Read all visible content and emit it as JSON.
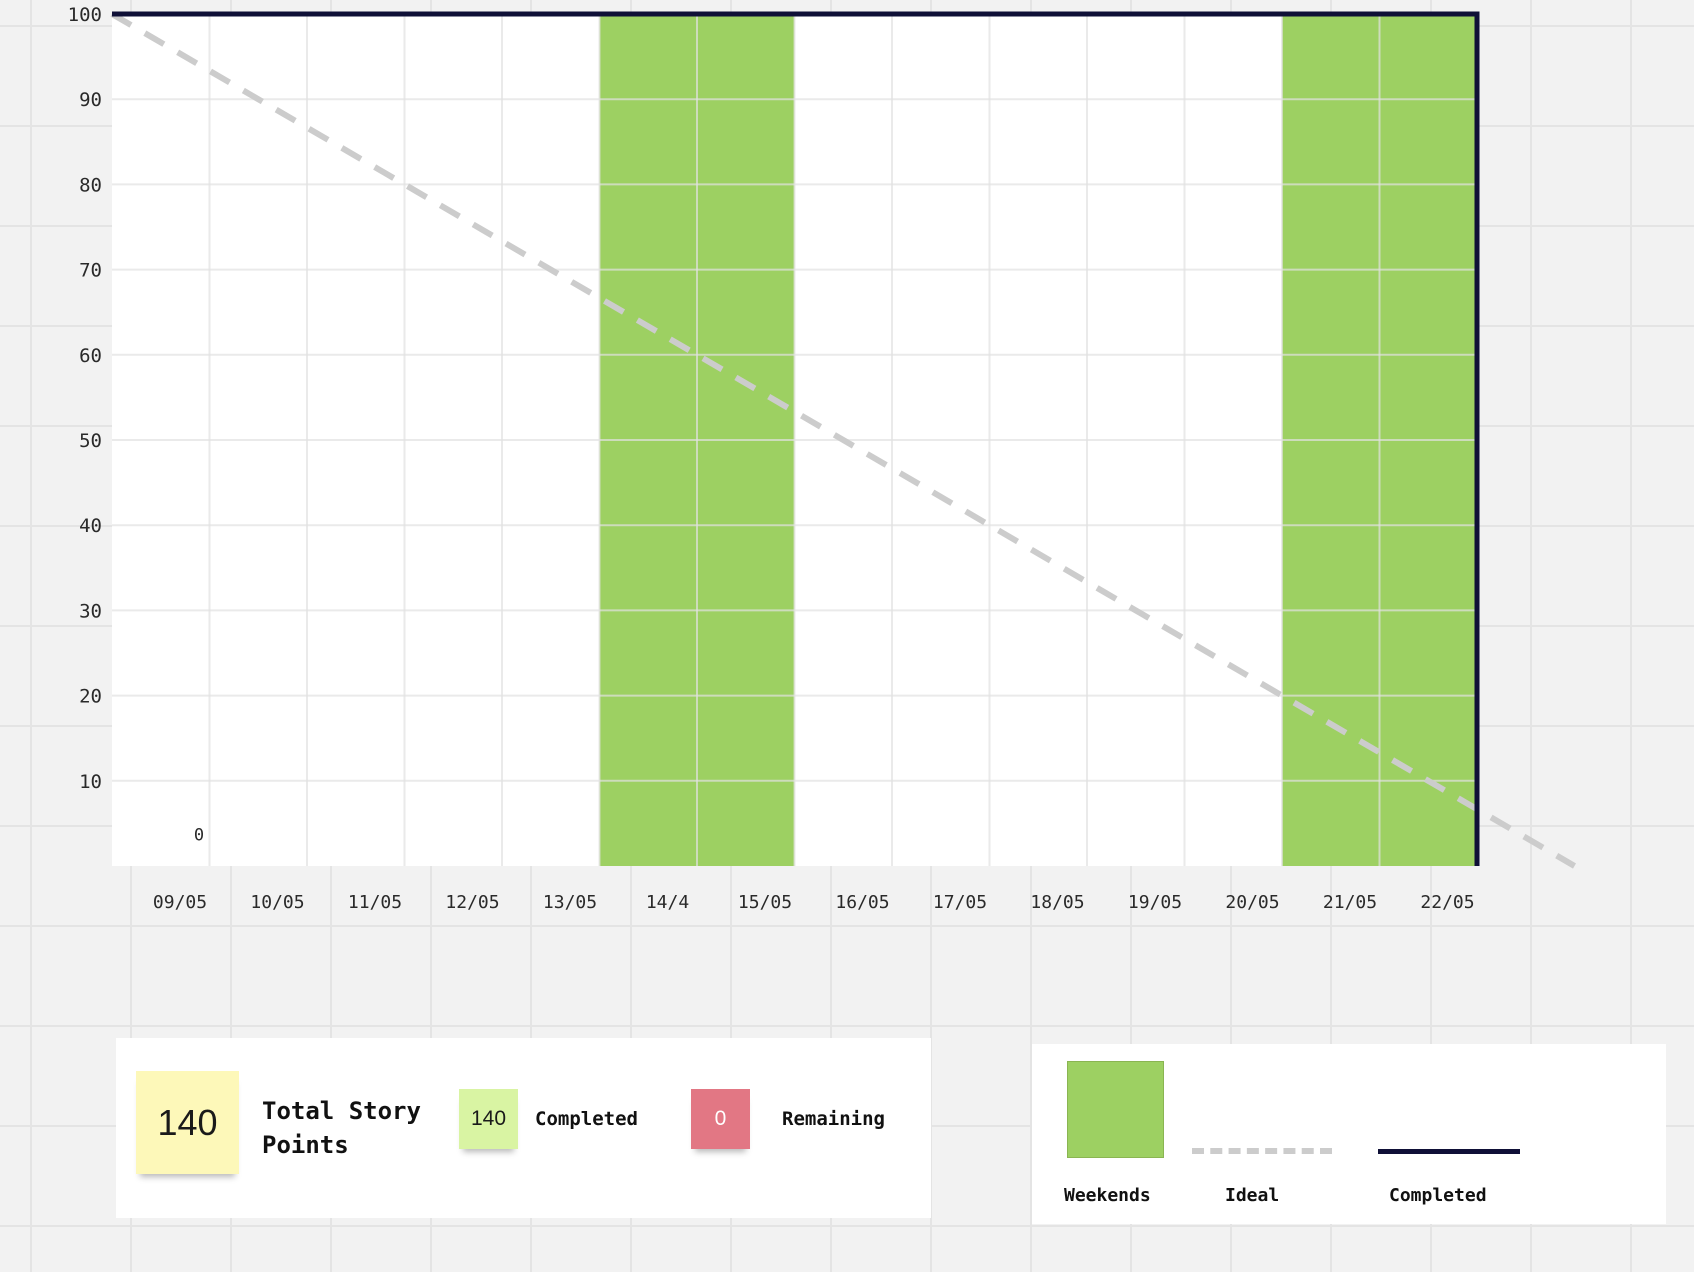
{
  "chart_data": {
    "type": "line",
    "title": "",
    "xlabel": "",
    "ylabel": "",
    "categories": [
      "09/05",
      "10/05",
      "11/05",
      "12/05",
      "13/05",
      "14/4",
      "15/05",
      "16/05",
      "17/05",
      "18/05",
      "19/05",
      "20/05",
      "21/05",
      "22/05"
    ],
    "y_ticks": [
      "100",
      "90",
      "80",
      "70",
      "60",
      "50",
      "40",
      "30",
      "20",
      "10"
    ],
    "ylim": [
      0,
      100
    ],
    "grid": true,
    "weekend_categories": [
      "14/4",
      "15/05",
      "21/05",
      "22/05"
    ],
    "series": [
      {
        "name": "Ideal",
        "style": "dashed",
        "color": "#cccccc",
        "x": [
          0,
          15
        ],
        "values": [
          100,
          0
        ]
      },
      {
        "name": "Completed",
        "style": "solid",
        "color": "#0f1037",
        "x": [
          0,
          14,
          14
        ],
        "values": [
          100,
          100,
          0
        ]
      }
    ],
    "annotations": [
      {
        "text": "0",
        "category": "09/05",
        "value": 3
      }
    ]
  },
  "summary": {
    "total_value": "140",
    "total_label": "Total Story Points",
    "completed_value": "140",
    "completed_label": "Completed",
    "remaining_value": "0",
    "remaining_label": "Remaining"
  },
  "legend": {
    "weekends_label": "Weekends",
    "ideal_label": "Ideal",
    "completed_label": "Completed"
  },
  "colors": {
    "weekend": "#9dd062",
    "ideal": "#cccccc",
    "completed": "#0f1037",
    "total_note": "#fdf8b9",
    "completed_note": "#d9f4a3",
    "remaining_note": "#e27784"
  }
}
